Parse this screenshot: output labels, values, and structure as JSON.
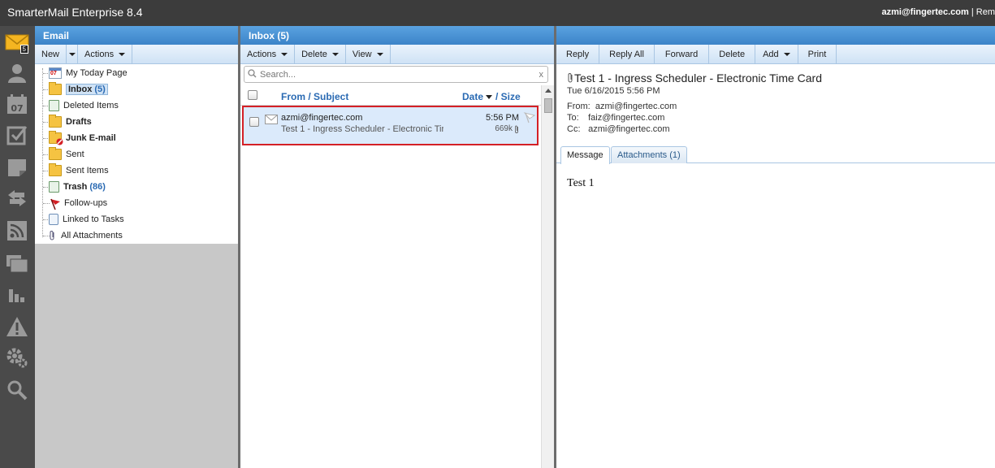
{
  "app": {
    "title": "SmarterMail Enterprise 8.4",
    "user": "azmi@fingertec.com",
    "user_suffix": "| Rem"
  },
  "rail": {
    "mail_badge": "5",
    "icons": [
      "mail-icon",
      "contacts-icon",
      "calendar-icon",
      "tasks-icon",
      "notes-icon",
      "sync-icon",
      "rss-icon",
      "file-storage-icon",
      "reports-icon",
      "alerts-icon",
      "settings-icon",
      "search-icon"
    ],
    "calendar_day": "07"
  },
  "email_panel": {
    "title": "Email",
    "toolbar": {
      "new": "New",
      "actions": "Actions"
    },
    "folders": [
      {
        "label": "My Today Page",
        "count": "",
        "bold": false,
        "icon": "calendar-icon"
      },
      {
        "label": "Inbox",
        "count": "(5)",
        "bold": true,
        "icon": "inbox-folder-icon"
      },
      {
        "label": "Deleted Items",
        "count": "",
        "bold": false,
        "icon": "deleted-items-icon"
      },
      {
        "label": "Drafts",
        "count": "",
        "bold": true,
        "icon": "drafts-folder-icon"
      },
      {
        "label": "Junk E-mail",
        "count": "",
        "bold": true,
        "icon": "junk-folder-icon"
      },
      {
        "label": "Sent",
        "count": "",
        "bold": false,
        "icon": "sent-folder-icon"
      },
      {
        "label": "Sent Items",
        "count": "",
        "bold": false,
        "icon": "sent-items-folder-icon"
      },
      {
        "label": "Trash",
        "count": "(86)",
        "bold": true,
        "icon": "trash-icon"
      },
      {
        "label": "Follow-ups",
        "count": "",
        "bold": false,
        "icon": "flag-icon"
      },
      {
        "label": "Linked to Tasks",
        "count": "",
        "bold": false,
        "icon": "task-icon"
      },
      {
        "label": "All Attachments",
        "count": "",
        "bold": false,
        "icon": "paperclip-icon"
      }
    ]
  },
  "inbox_panel": {
    "title": "Inbox (5)",
    "toolbar": {
      "actions": "Actions",
      "delete": "Delete",
      "view": "View"
    },
    "search_placeholder": "Search...",
    "columns": {
      "from_subject": "From / Subject",
      "date": "Date",
      "size": "/ Size"
    },
    "messages": [
      {
        "from": "azmi@fingertec.com",
        "subject": "Test 1 - Ingress Scheduler - Electronic Tir",
        "time": "5:56 PM",
        "size": "669k"
      }
    ]
  },
  "reading_pane": {
    "toolbar": {
      "reply": "Reply",
      "reply_all": "Reply All",
      "forward": "Forward",
      "delete": "Delete",
      "add": "Add",
      "print": "Print"
    },
    "title": "Test 1 - Ingress Scheduler - Electronic Time Card",
    "date": "Tue 6/16/2015 5:56 PM",
    "from_label": "From:",
    "from": "azmi@fingertec.com",
    "to_label": "To:",
    "to": "faiz@fingertec.com",
    "cc_label": "Cc:",
    "cc": "azmi@fingertec.com",
    "tabs": {
      "message": "Message",
      "attachments": "Attachments (1)"
    },
    "body": "Test 1"
  },
  "colors": {
    "header_blue": "#3c84c8",
    "selection_border": "#d42026",
    "selection_bg": "#dbeafb",
    "link_blue": "#2a6ab3"
  }
}
